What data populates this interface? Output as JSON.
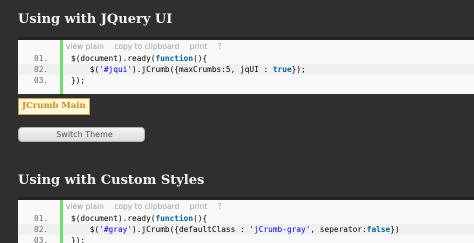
{
  "section1": {
    "title": "Using with JQuery UI",
    "toolbar": [
      "view plain",
      "copy to clipboard",
      "print",
      "?"
    ],
    "lines": [
      {
        "num": "01.",
        "parts": [
          {
            "t": "$(document).ready("
          },
          {
            "t": "function",
            "c": "kw"
          },
          {
            "t": "(){"
          }
        ]
      },
      {
        "num": "02.",
        "parts": [
          {
            "t": "    $("
          },
          {
            "t": "'#jqui'",
            "c": "str"
          },
          {
            "t": ").jCrumb({maxCrumbs:5, jqUI : "
          },
          {
            "t": "true",
            "c": "kw"
          },
          {
            "t": "});"
          }
        ]
      },
      {
        "num": "03.",
        "parts": [
          {
            "t": "});"
          }
        ]
      }
    ]
  },
  "buttons": {
    "jcrumb_main": "JCrumb Main",
    "switch_theme": "Switch Theme"
  },
  "section2": {
    "title": "Using with Custom Styles",
    "toolbar": [
      "view plain",
      "copy to clipboard",
      "print",
      "?"
    ],
    "lines": [
      {
        "num": "01.",
        "parts": [
          {
            "t": "$(document).ready("
          },
          {
            "t": "function",
            "c": "kw"
          },
          {
            "t": "(){"
          }
        ]
      },
      {
        "num": "02.",
        "parts": [
          {
            "t": "    $("
          },
          {
            "t": "'#gray'",
            "c": "str"
          },
          {
            "t": ").jCrumb({defaultClass : "
          },
          {
            "t": "'jCrumb-gray'",
            "c": "str"
          },
          {
            "t": ", seperator:"
          },
          {
            "t": "false",
            "c": "kw"
          },
          {
            "t": "})"
          }
        ]
      },
      {
        "num": "03.",
        "parts": [
          {
            "t": "});"
          }
        ]
      }
    ]
  }
}
